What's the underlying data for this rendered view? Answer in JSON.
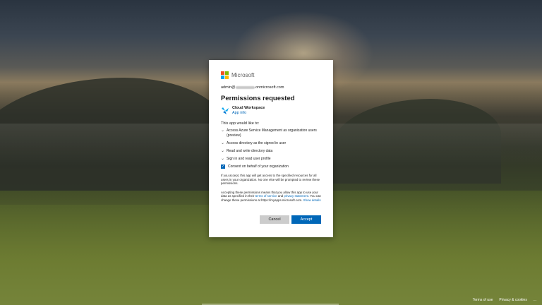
{
  "brand": {
    "name": "Microsoft"
  },
  "account": {
    "prefix": "admin@",
    "suffix": ".onmicrosoft.com"
  },
  "dialog": {
    "title": "Permissions requested",
    "app_name": "Cloud Workspace",
    "app_info_link": "App info",
    "would_like": "This app would like to:",
    "permissions": [
      "Access Azure Service Management as organization users (preview)",
      "Access directory as the signed in user",
      "Read and write directory data",
      "Sign in and read user profile"
    ],
    "consent_label": "Consent on behalf of your organization",
    "consent_checked": true,
    "para1": "If you accept, this app will get access to the specified resources for all users in your organization. No one else will be prompted to review these permissions.",
    "para2_start": "Accepting these permissions means that you allow this app to use your data as specified in their ",
    "terms_link": "terms of service",
    "para2_and": " and ",
    "privacy_link": "privacy statement",
    "para2_end": ". You can change these permissions at https://myapps.microsoft.com. ",
    "show_details_link": "Show details",
    "cancel_label": "Cancel",
    "accept_label": "Accept"
  },
  "footer": {
    "terms": "Terms of use",
    "privacy": "Privacy & cookies",
    "more": "..."
  },
  "colors": {
    "accent": "#0067b8",
    "logo_red": "#f25022",
    "logo_green": "#7fba00",
    "logo_blue": "#00a4ef",
    "logo_yellow": "#ffb900"
  },
  "icons": {
    "app": "cloud-workspace-bird-icon",
    "chevron": "chevron-down-icon",
    "checkbox": "checkmark-icon"
  }
}
